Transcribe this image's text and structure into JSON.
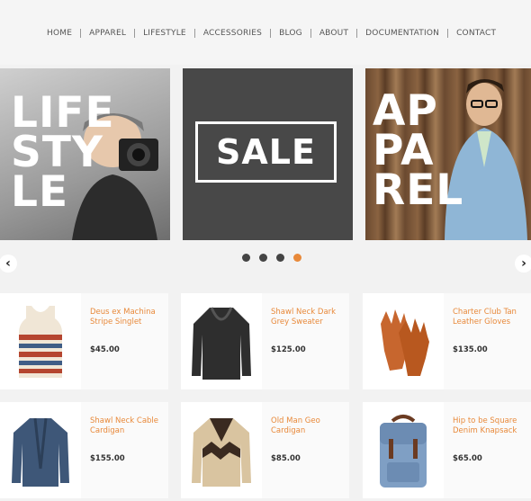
{
  "nav": {
    "items": [
      {
        "label": "HOME"
      },
      {
        "label": "APPAREL"
      },
      {
        "label": "LIFESTYLE"
      },
      {
        "label": "ACCESSORIES"
      },
      {
        "label": "BLOG"
      },
      {
        "label": "ABOUT"
      },
      {
        "label": "DOCUMENTATION"
      },
      {
        "label": "CONTACT"
      }
    ]
  },
  "slider": {
    "left_panel": {
      "lines": [
        "LIFE",
        "STY",
        "LE"
      ]
    },
    "center_panel": {
      "text": "SALE"
    },
    "right_panel": {
      "lines": [
        "AP",
        "PA",
        "REL"
      ]
    },
    "dots_count": 4,
    "active_dot": 4
  },
  "products": [
    {
      "name": "Deus ex Machina Stripe Singlet",
      "price": "$45.00",
      "icon": "tank-top-icon"
    },
    {
      "name": "Shawl Neck Dark Grey Sweater",
      "price": "$125.00",
      "icon": "sweater-icon"
    },
    {
      "name": "Charter Club Tan Leather Gloves",
      "price": "$135.00",
      "icon": "gloves-icon"
    },
    {
      "name": "Shawl Neck Cable Cardigan",
      "price": "$155.00",
      "icon": "cardigan-icon"
    },
    {
      "name": "Old Man Geo Cardigan",
      "price": "$85.00",
      "icon": "geo-cardigan-icon"
    },
    {
      "name": "Hip to be Square Denim Knapsack",
      "price": "$65.00",
      "icon": "backpack-icon"
    }
  ],
  "colors": {
    "accent": "#e8893a",
    "sale_bg": "#484848",
    "page_bg": "#f2f2f2"
  }
}
